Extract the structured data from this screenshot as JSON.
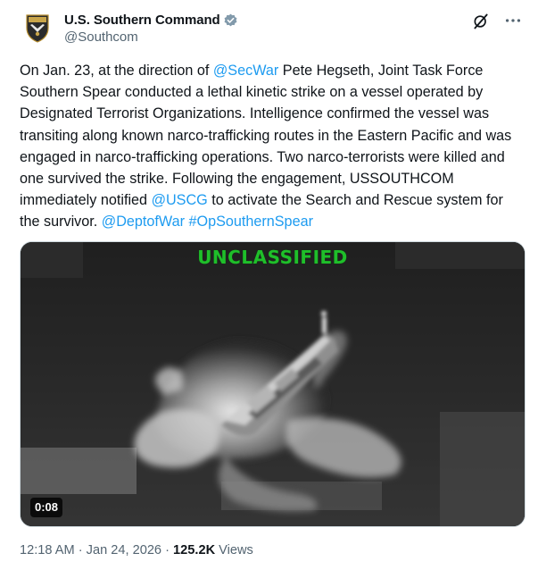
{
  "author": {
    "display_name": "U.S. Southern Command",
    "handle": "@Southcom",
    "avatar_icon": "southcom-seal-icon",
    "verified_icon": "verified-badge-icon",
    "verified_color": "#829aab"
  },
  "actions": {
    "grok_icon": "grok-icon",
    "more_icon": "more-options-icon"
  },
  "text": {
    "p1": "On Jan. 23, at the direction of ",
    "mention_secwar": "@SecWar",
    "p2": " Pete Hegseth, Joint Task Force Southern Spear conducted a lethal kinetic strike on a vessel operated by Designated Terrorist Organizations. Intelligence confirmed the vessel was transiting along known narco-trafficking routes in the Eastern Pacific and was engaged in narco-trafficking operations. Two narco-terrorists were killed and one survived the strike. Following the engagement, USSOUTHCOM immediately notified ",
    "mention_uscg": "@USCG",
    "p3": " to activate the Search and Rescue system for the survivor. ",
    "mention_deptofwar": "@DeptofWar",
    "hashtag": "#OpSouthernSpear",
    "link_color": "#1d9bf0"
  },
  "media": {
    "classification_label": "UNCLASSIFIED",
    "classification_color": "#1fbf2a",
    "duration": "0:08"
  },
  "meta": {
    "time": "12:18 AM",
    "separator": " · ",
    "date": "Jan 24, 2026",
    "views_count": "125.2K",
    "views_label": "Views"
  }
}
